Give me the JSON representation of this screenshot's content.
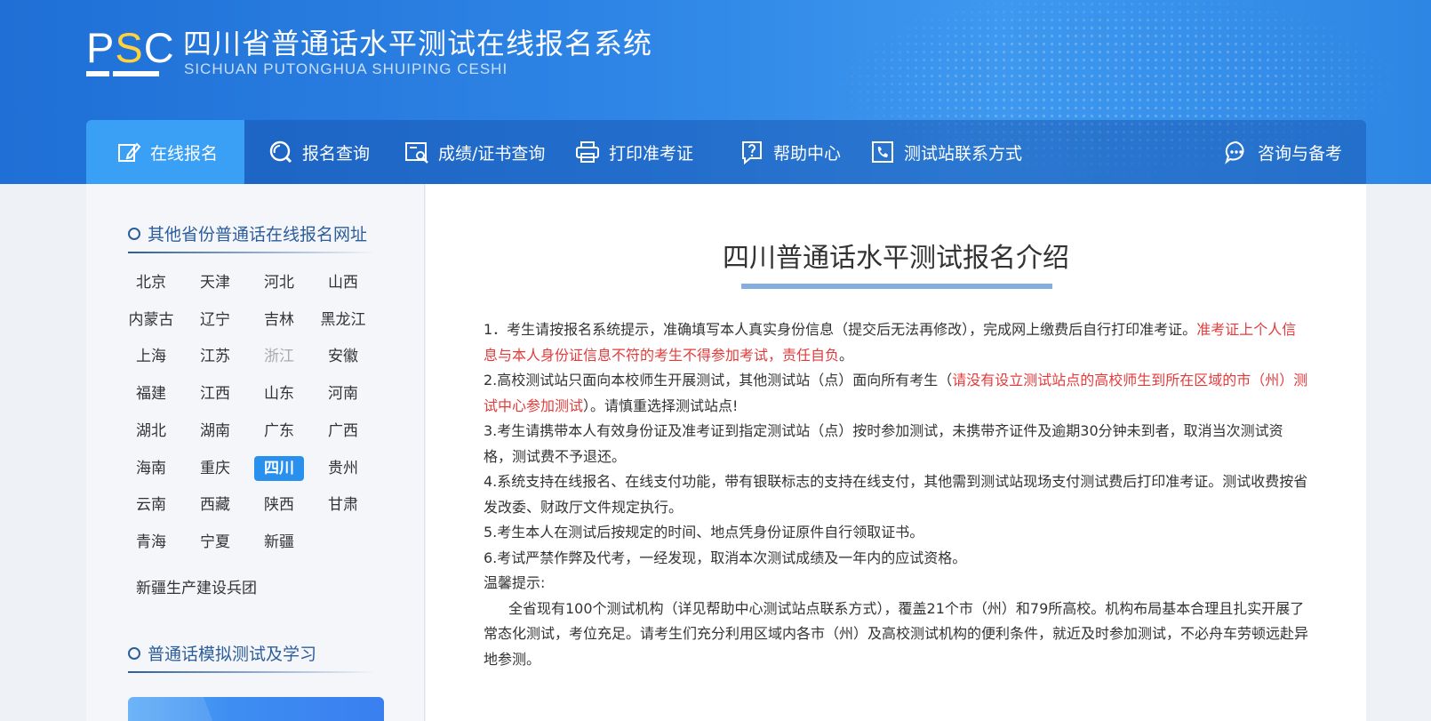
{
  "header": {
    "logo_text_p": "P",
    "logo_text_s": "S",
    "logo_text_c": "C",
    "title": "四川省普通话水平测试在线报名系统",
    "subtitle": "SICHUAN PUTONGHUA SHUIPING CESHI"
  },
  "nav": {
    "items": [
      {
        "label": "在线报名",
        "icon": "edit-icon"
      },
      {
        "label": "报名查询",
        "icon": "search-icon"
      },
      {
        "label": "成绩/证书查询",
        "icon": "certificate-search-icon"
      },
      {
        "label": "打印准考证",
        "icon": "printer-icon"
      },
      {
        "label": "帮助中心",
        "icon": "help-icon"
      },
      {
        "label": "测试站联系方式",
        "icon": "contact-phone-icon"
      },
      {
        "label": "咨询与备考",
        "icon": "chat-icon"
      }
    ],
    "active_index": 0
  },
  "sidebar": {
    "section1_title": "其他省份普通话在线报名网址",
    "provinces": [
      "北京",
      "天津",
      "河北",
      "山西",
      "内蒙古",
      "辽宁",
      "吉林",
      "黑龙江",
      "上海",
      "江苏",
      "浙江",
      "安徽",
      "福建",
      "江西",
      "山东",
      "河南",
      "湖北",
      "湖南",
      "广东",
      "广西",
      "海南",
      "重庆",
      "四川",
      "贵州",
      "云南",
      "西藏",
      "陕西",
      "甘肃",
      "青海",
      "宁夏",
      "新疆"
    ],
    "active_province": "四川",
    "disabled_province": "浙江",
    "extra_item": "新疆生产建设兵团",
    "section2_title": "普通话模拟测试及学习"
  },
  "main": {
    "title": "四川普通话水平测试报名介绍",
    "p1_a": "1．考生请按报名系统提示，准确填写本人真实身份信息（提交后无法再修改），完成网上缴费后自行打印准考证。",
    "p1_red": "准考证上个人信息与本人身份证信息不符的考生不得参加考试，责任自负",
    "p1_b": "。",
    "p2_a": "2.高校测试站只面向本校师生开展测试，其他测试站（点）面向所有考生（",
    "p2_red": "请没有设立测试站点的高校师生到所在区域的市（州）测试中心参加测试",
    "p2_b": "）。请慎重选择测试站点!",
    "p3": "3.考生请携带本人有效身份证及准考证到指定测试站（点）按时参加测试，未携带齐证件及逾期30分钟未到者，取消当次测试资格，测试费不予退还。",
    "p4": "4.系统支持在线报名、在线支付功能，带有银联标志的支持在线支付，其他需到测试站现场支付测试费后打印准考证。测试收费按省发改委、财政厅文件规定执行。",
    "p5": "5.考生本人在测试后按规定的时间、地点凭身份证原件自行领取证书。",
    "p6": "6.考试严禁作弊及代考，一经发现，取消本次测试成绩及一年内的应试资格。",
    "tip_label": "温馨提示:",
    "tip_body": "全省现有100个测试机构（详见帮助中心测试站点联系方式），覆盖21个市（州）和79所高校。机构布局基本合理且扎实开展了常态化测试，考位充足。请考生们充分利用区域内各市（州）及高校测试机构的便利条件，就近及时参加测试，不必舟车劳顿远赴异地参测。"
  },
  "colors": {
    "header_blue": "#2f86e6",
    "active_blue": "#3aa0f5",
    "warning_red": "#e33b3b",
    "sidebar_title": "#2d5d9a"
  }
}
